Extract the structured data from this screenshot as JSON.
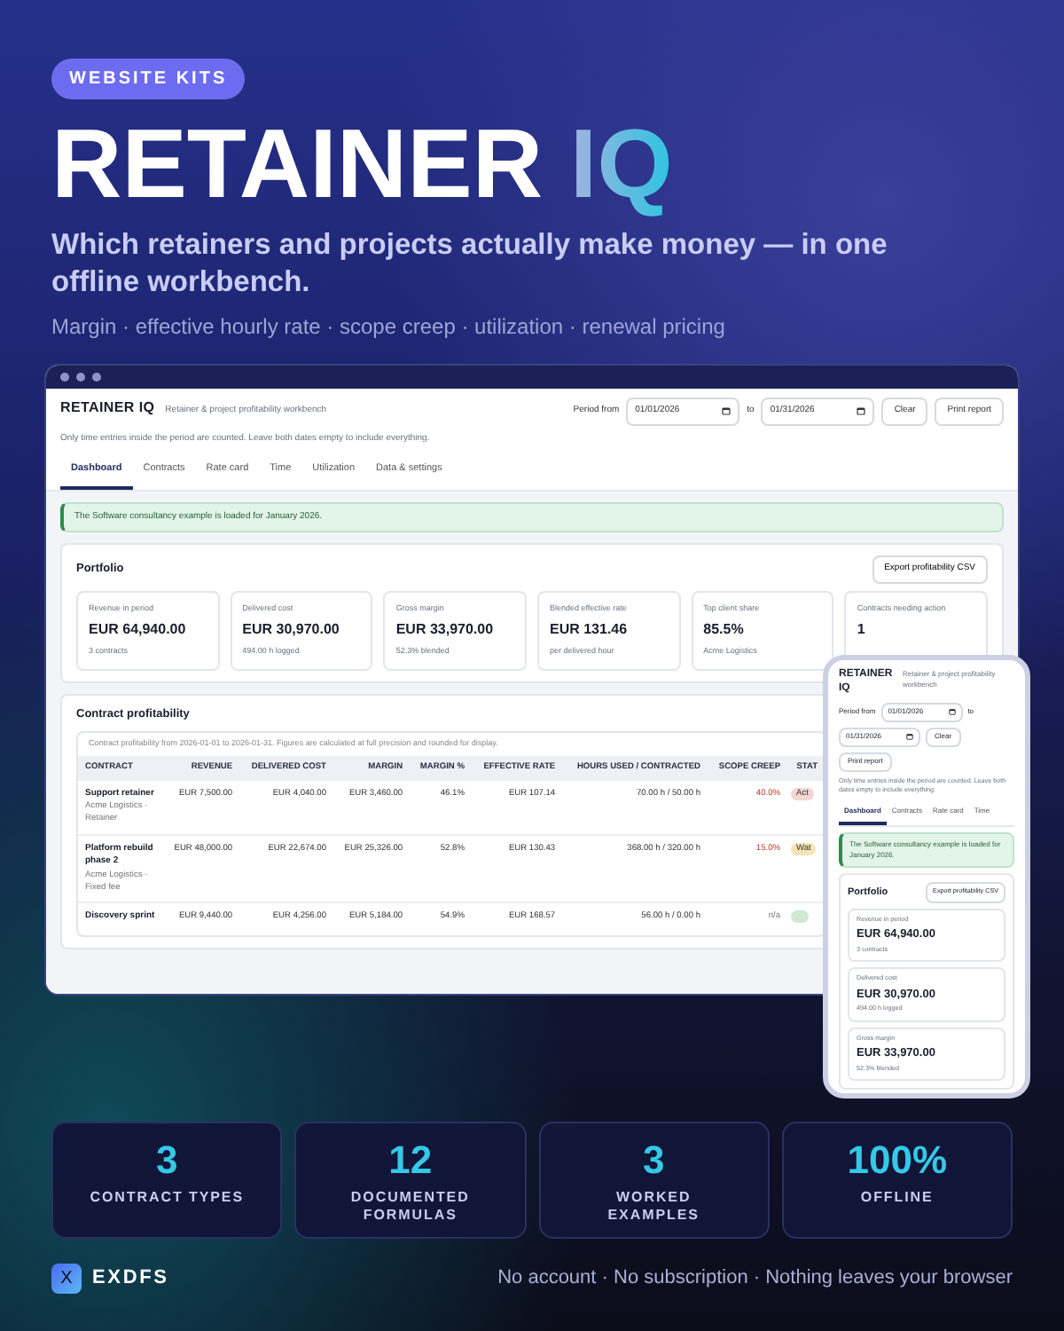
{
  "badge": "WEBSITE KITS",
  "title": {
    "main": "RETAINER",
    "accent": "IQ"
  },
  "headline": "Which retainers and projects actually make money — in one offline workbench.",
  "tagline": "Margin · effective hourly rate · scope creep · utilization · renewal pricing",
  "desktop": {
    "app_name": "RETAINER IQ",
    "app_subtitle": "Retainer & project profitability workbench",
    "period_label": "Period from",
    "date_from": "01/01/2026",
    "to_label": "to",
    "date_to": "01/31/2026",
    "buttons": [
      "Clear",
      "Print report"
    ],
    "note": "Only time entries inside the period are counted. Leave both dates empty to include everything.",
    "tabs": [
      {
        "label": "Dashboard",
        "selected": true
      },
      {
        "label": "Contracts",
        "selected": false
      },
      {
        "label": "Rate card",
        "selected": false
      },
      {
        "label": "Time",
        "selected": false
      },
      {
        "label": "Utilization",
        "selected": false
      },
      {
        "label": "Data & settings",
        "selected": false
      }
    ],
    "alert": "The Software consultancy example is loaded for January 2026.",
    "portfolio": {
      "title": "Portfolio",
      "export": "Export profitability CSV",
      "cards": [
        {
          "label": "Revenue in period",
          "value": "EUR 64,940.00",
          "sub": "3 contracts"
        },
        {
          "label": "Delivered cost",
          "value": "EUR 30,970.00",
          "sub": "494.00 h logged"
        },
        {
          "label": "Gross margin",
          "value": "EUR 33,970.00",
          "sub": "52.3% blended"
        },
        {
          "label": "Blended effective rate",
          "value": "EUR 131.46",
          "sub": "per delivered hour"
        },
        {
          "label": "Top client share",
          "value": "85.5%",
          "sub": "Acme Logistics"
        },
        {
          "label": "Contracts needing action",
          "value": "1"
        }
      ]
    },
    "table": {
      "title": "Contract profitability",
      "caption": "Contract profitability from 2026-01-01 to 2026-01-31. Figures are calculated at full precision and rounded for display.",
      "columns": [
        "CONTRACT",
        "REVENUE",
        "DELIVERED COST",
        "MARGIN",
        "MARGIN %",
        "EFFECTIVE RATE",
        "HOURS USED / CONTRACTED",
        "SCOPE CREEP",
        "STAT"
      ],
      "rows": [
        {
          "cells": [
            "Support retainer",
            "EUR 7,500.00",
            "EUR 4,040.00",
            "EUR 3,460.00",
            "46.1%",
            "EUR 107.14",
            "70.00 h / 50.00 h",
            "40.0%",
            "Act"
          ],
          "client": "Acme Logistics · Retainer",
          "scope_alert": true,
          "color": "#f3d6d3"
        },
        {
          "cells": [
            "Platform rebuild phase 2",
            "EUR 48,000.00",
            "EUR 22,674.00",
            "EUR 25,326.00",
            "52.8%",
            "EUR 130.43",
            "368.00 h / 320.00 h",
            "15.0%",
            "Wat"
          ],
          "client": "Acme Logistics · Fixed fee",
          "scope_alert": true,
          "color": "#f6e3b4"
        },
        {
          "cells": [
            "Discovery sprint",
            "EUR 9,440.00",
            "EUR 4,256.00",
            "EUR 5,184.00",
            "54.9%",
            "EUR 168.57",
            "56.00 h / 0.00 h",
            "n/a"
          ],
          "scope_alert": false,
          "color": "#cfe9d2"
        }
      ]
    }
  },
  "phone": {
    "app_name": "RETAINER IQ",
    "app_subtitle": "Retainer & project profitability workbench",
    "period_label": "Period from",
    "date_from": "01/01/2026",
    "to_label": "to",
    "date_to": "01/31/2026",
    "buttons": [
      "Clear",
      "Print report"
    ],
    "note": "Only time entries inside the period are counted. Leave both dates empty to include everything.",
    "tabs": [
      {
        "label": "Dashboard",
        "selected": true
      },
      {
        "label": "Contracts",
        "selected": false
      },
      {
        "label": "Rate card",
        "selected": false
      },
      {
        "label": "Time",
        "selected": false
      }
    ],
    "alert": "The Software consultancy example is loaded for January 2026.",
    "portfolio": {
      "title": "Portfolio",
      "export": "Export profitability CSV",
      "cards": [
        {
          "label": "Revenue in period",
          "value": "EUR 64,940.00",
          "sub": "3 contracts"
        },
        {
          "label": "Delivered cost",
          "value": "EUR 30,970.00",
          "sub": "494.00 h logged"
        },
        {
          "label": "Gross margin",
          "value": "EUR 33,970.00",
          "sub": "52.3% blended"
        }
      ]
    }
  },
  "stats": [
    {
      "value": "3",
      "label": "CONTRACT TYPES"
    },
    {
      "value": "12",
      "label": "DOCUMENTED FORMULAS"
    },
    {
      "value": "3",
      "label": "WORKED EXAMPLES"
    },
    {
      "value": "100%",
      "label": "OFFLINE"
    }
  ],
  "brand": {
    "logo": "X",
    "name": "EXDFS"
  },
  "footer_note": "No account · No subscription · Nothing leaves your browser"
}
